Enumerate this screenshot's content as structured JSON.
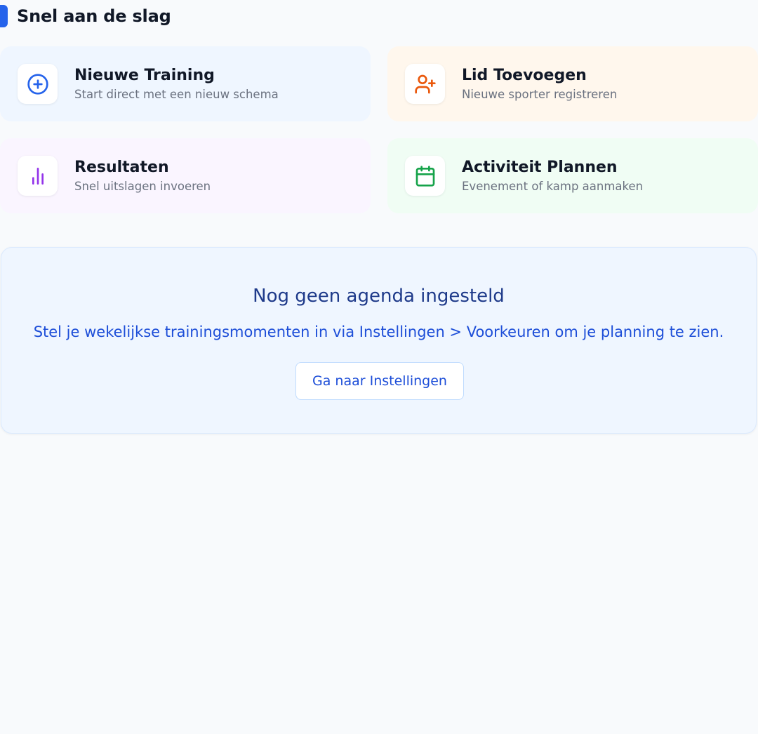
{
  "section": {
    "title": "Snel aan de slag",
    "accent_color": "#2563eb"
  },
  "quick_actions": [
    {
      "title": "Nieuwe Training",
      "subtitle": "Start direct met een nieuw schema",
      "icon": "plus-circle-icon",
      "color": "#2563eb",
      "bg": "#eff6ff"
    },
    {
      "title": "Lid Toevoegen",
      "subtitle": "Nieuwe sporter registreren",
      "icon": "user-plus-icon",
      "color": "#ea580c",
      "bg": "#fff7ed"
    },
    {
      "title": "Resultaten",
      "subtitle": "Snel uitslagen invoeren",
      "icon": "bar-chart-icon",
      "color": "#9333ea",
      "bg": "#faf5ff"
    },
    {
      "title": "Activiteit Plannen",
      "subtitle": "Evenement of kamp aanmaken",
      "icon": "calendar-icon",
      "color": "#16a34a",
      "bg": "#f0fdf4"
    }
  ],
  "empty_state": {
    "title": "Nog geen agenda ingesteld",
    "description": "Stel je wekelijkse trainingsmomenten in via Instellingen > Voorkeuren om je planning te zien.",
    "button_label": "Ga naar Instellingen"
  }
}
